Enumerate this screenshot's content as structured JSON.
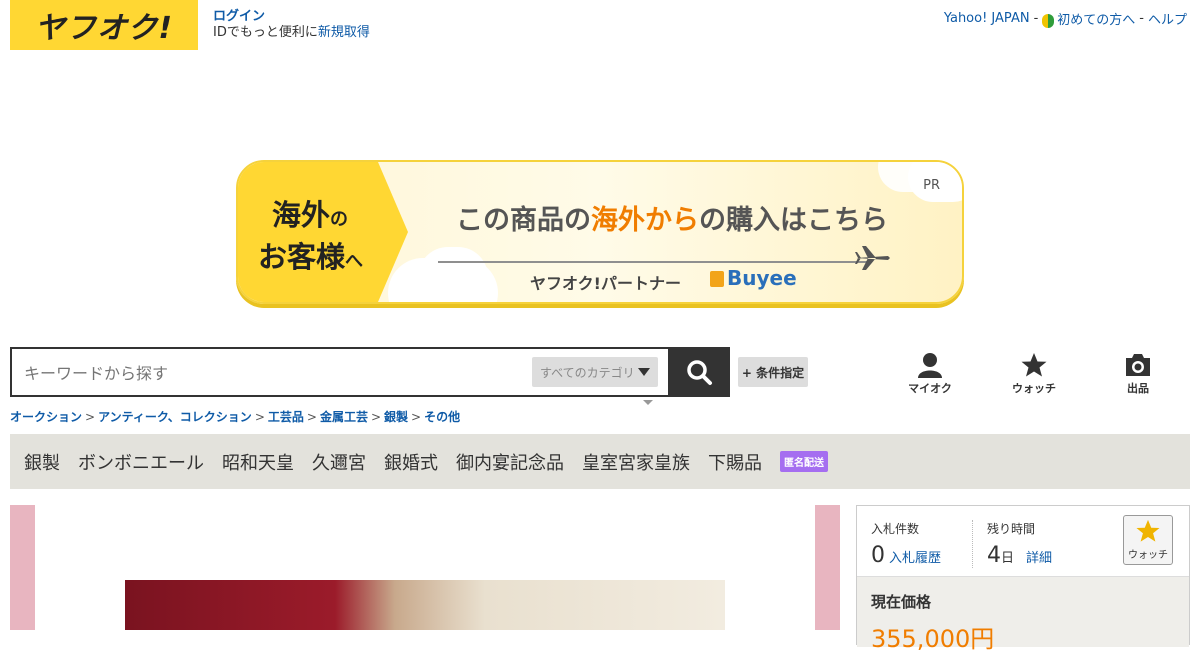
{
  "header": {
    "logo_text": "ヤフオク!",
    "login_label": "ログイン",
    "login_desc_prefix": "IDでもっと便利に",
    "signup_link": "新規取得",
    "links": [
      "Yahoo! JAPAN",
      "初めての方へ",
      "ヘルプ"
    ],
    "separator": "-"
  },
  "banner": {
    "left_line1_big": "海外",
    "left_line1_small": "の",
    "left_line2_big": "お客様",
    "left_line2_small": "へ",
    "headline_pre": "この商品の",
    "headline_highlight": "海外から",
    "headline_post": "の購入はこちら",
    "partner_text": "ヤフオク!パートナー",
    "buyee_text": "Buyee",
    "pr_label": "PR"
  },
  "search": {
    "placeholder": "キーワードから探す",
    "category_label": "すべてのカテゴリ",
    "condition_button": "+ 条件指定"
  },
  "nav_icons": [
    {
      "label": "マイオク",
      "icon": "person-icon"
    },
    {
      "label": "ウォッチ",
      "icon": "star-icon"
    },
    {
      "label": "出品",
      "icon": "camera-icon"
    }
  ],
  "breadcrumb": [
    "オークション",
    "アンティーク、コレクション",
    "工芸品",
    "金属工芸",
    "銀製",
    "その他"
  ],
  "tags": [
    "銀製",
    "ボンボニエール",
    "昭和天皇",
    "久邇宮",
    "銀婚式",
    "御内宴記念品",
    "皇室宮家皇族",
    "下賜品"
  ],
  "anon_badge": "匿名配送",
  "auction": {
    "bids_label": "入札件数",
    "bids_count": "0",
    "bids_link": "入札履歴",
    "remaining_label": "残り時間",
    "remaining_value": "4",
    "remaining_unit": "日",
    "detail_link": "詳細",
    "watch_label": "ウォッチ",
    "current_price_label": "現在価格",
    "current_price_value": "355,000円"
  },
  "colors": {
    "brand_yellow": "#ffd733",
    "link_blue": "#0f5ba7",
    "accent_orange": "#f07d00",
    "tag_bar": "#e3e2dc",
    "anon_purple": "#a56ef0"
  }
}
